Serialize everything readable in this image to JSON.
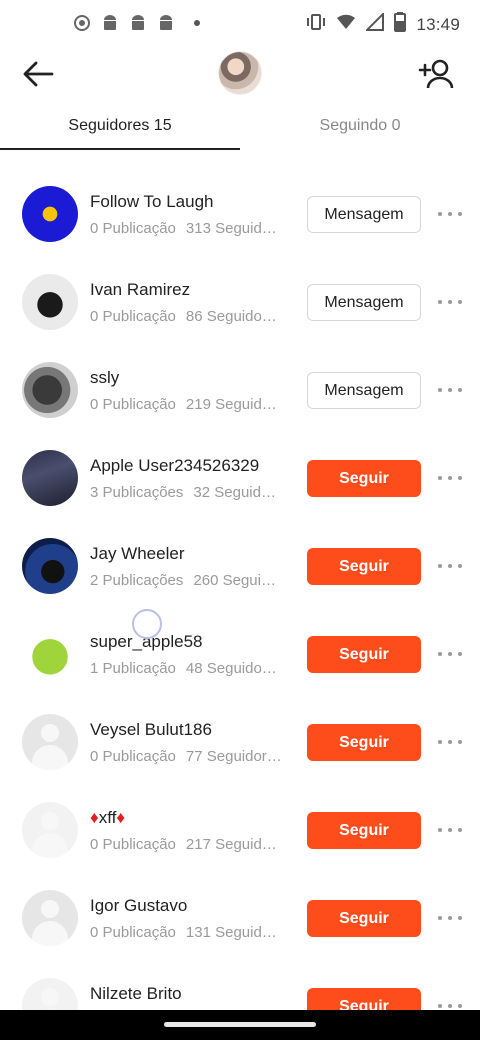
{
  "status_bar": {
    "time": "13:49",
    "left_icons": [
      "record-icon",
      "android-icon",
      "android-icon",
      "android-icon",
      "dot-icon"
    ],
    "right_icons": [
      "vibrate-icon",
      "wifi-icon",
      "signal-icon",
      "battery-icon"
    ]
  },
  "header": {
    "back_icon": "arrow-left-icon",
    "add_user_icon": "add-user-icon"
  },
  "tabs": [
    {
      "label": "Seguidores 15",
      "active": true
    },
    {
      "label": "Seguindo 0",
      "active": false
    }
  ],
  "colors": {
    "accent": "#fe4c1b",
    "text": "#222222",
    "muted": "#9a9a9a"
  },
  "users": [
    {
      "name": "Follow To Laugh",
      "pubs": "0 Publicação",
      "followers": "313 Seguid…",
      "button": "Mensagem",
      "type": "msg"
    },
    {
      "name": "Ivan Ramirez",
      "pubs": "0 Publicação",
      "followers": "86 Seguido…",
      "button": "Mensagem",
      "type": "msg"
    },
    {
      "name": "ssly",
      "pubs": "0 Publicação",
      "followers": "219 Seguid…",
      "button": "Mensagem",
      "type": "msg"
    },
    {
      "name": "Apple User234526329",
      "pubs": "3 Publicações",
      "followers": "32 Seguid…",
      "button": "Seguir",
      "type": "follow"
    },
    {
      "name": "Jay Wheeler",
      "pubs": "2 Publicações",
      "followers": "260 Segui…",
      "button": "Seguir",
      "type": "follow"
    },
    {
      "name": "super_apple58",
      "pubs": "1 Publicação",
      "followers": "48 Seguido…",
      "button": "Seguir",
      "type": "follow"
    },
    {
      "name": "Veysel Bulut186",
      "pubs": "0 Publicação",
      "followers": "77 Seguidor…",
      "button": "Seguir",
      "type": "follow"
    },
    {
      "name": "♦xff♦",
      "pubs": "0 Publicação",
      "followers": "217 Seguid…",
      "button": "Seguir",
      "type": "follow"
    },
    {
      "name": "Igor Gustavo",
      "pubs": "0 Publicação",
      "followers": "131 Seguid…",
      "button": "Seguir",
      "type": "follow"
    },
    {
      "name": "Nilzete Brito",
      "pubs": "",
      "followers": "",
      "button": "Seguir",
      "type": "follow"
    }
  ]
}
